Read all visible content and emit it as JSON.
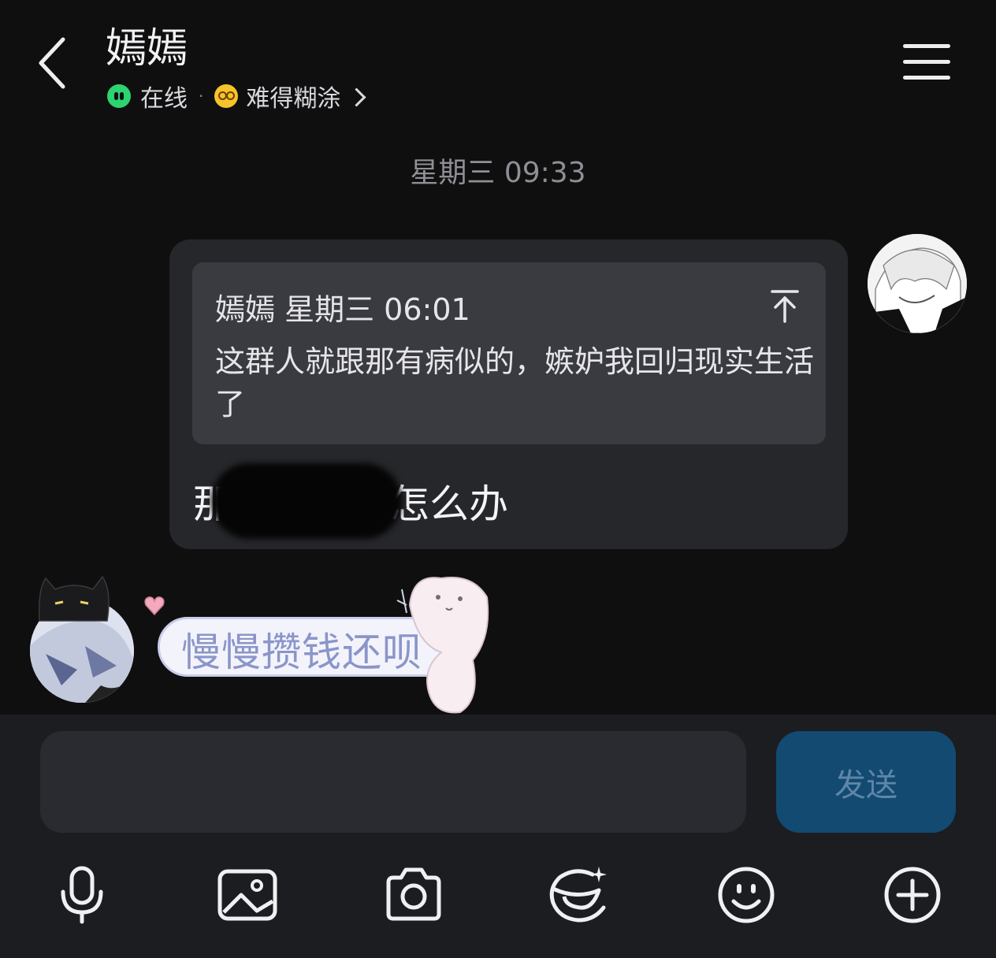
{
  "header": {
    "title": "嫣嫣",
    "status": "在线",
    "separator": "·",
    "mood": "难得糊涂"
  },
  "conversation": {
    "timestamp": "星期三 09:33",
    "message": {
      "quote_header": "嫣嫣 星期三 06:01",
      "quote_text": "这群人就跟那有病似的，嫉妒我回归现实生活了",
      "text": "那砖窑的钱怎么办"
    },
    "reply_sticker_text": "慢慢攒钱还呗"
  },
  "composer": {
    "input_value": "",
    "send_label": "发送"
  },
  "toolbar": {
    "icons": [
      "microphone-icon",
      "image-icon",
      "camera-icon",
      "emoji-sticker-icon",
      "smiley-icon",
      "plus-icon"
    ]
  },
  "colors": {
    "background": "#0f0f10",
    "bubble": "#26272b",
    "quote": "#3a3b40",
    "send_button": "#124a72",
    "online_green": "#2dd36f"
  }
}
